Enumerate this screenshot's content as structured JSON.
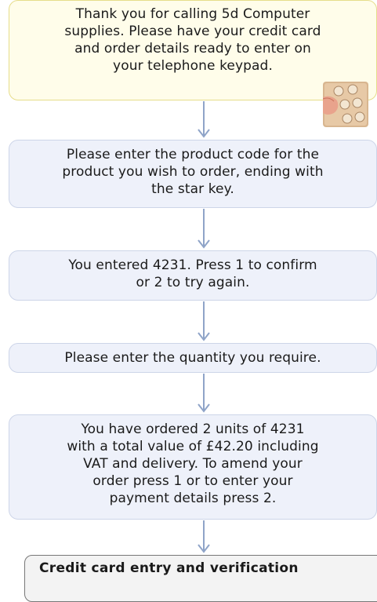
{
  "flow": {
    "welcome": "Thank you for calling 5d Computer\nsupplies. Please have your credit card\nand order details ready to enter on\nyour telephone keypad.",
    "steps": [
      "Please enter the product code for the\nproduct you wish to order, ending with\nthe star key.",
      "You entered 4231. Press 1 to confirm\nor 2 to try again.",
      "Please enter the quantity you require.",
      "You have ordered 2 units of 4231\nwith a total value of £42.20 including\nVAT and delivery. To amend your\norder press 1 or to enter your\npayment details press 2."
    ],
    "final": "Credit card entry and verification"
  },
  "icons": {
    "keypad": "telephone-keypad-icon",
    "arrow": "arrow-down-icon"
  },
  "colors": {
    "welcome_bg": "#fffdea",
    "step_bg": "#eef1fa",
    "arrow": "#8fa4c8"
  }
}
